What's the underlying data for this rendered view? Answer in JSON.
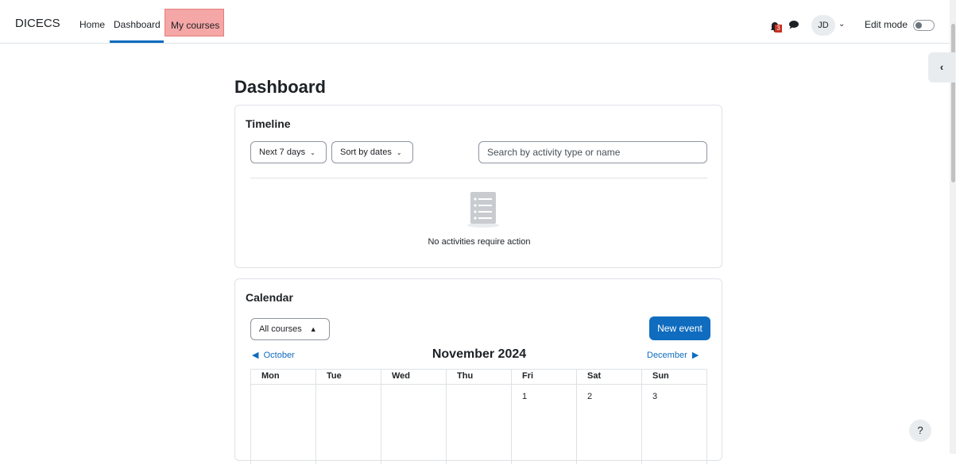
{
  "navbar": {
    "brand": "DICECS",
    "items": [
      {
        "label": "Home"
      },
      {
        "label": "Dashboard"
      },
      {
        "label": "My courses"
      }
    ],
    "notification_count": "3",
    "user_initials": "JD",
    "edit_mode_label": "Edit mode"
  },
  "help_label": "?",
  "page": {
    "title": "Dashboard"
  },
  "timeline": {
    "title": "Timeline",
    "filter_label": "Next 7 days",
    "sort_label": "Sort by dates",
    "search_placeholder": "Search by activity type or name",
    "empty_message": "No activities require action"
  },
  "calendar": {
    "title": "Calendar",
    "course_select": "All courses",
    "new_event_label": "New event",
    "prev_month": "October",
    "current_month": "November 2024",
    "next_month": "December",
    "weekdays": [
      "Mon",
      "Tue",
      "Wed",
      "Thu",
      "Fri",
      "Sat",
      "Sun"
    ],
    "first_row_days": [
      "",
      "",
      "",
      "",
      "1",
      "2",
      "3"
    ]
  },
  "colors": {
    "accent": "#0f6cbf",
    "highlight": "#f5a6a6",
    "badge": "#ca3120"
  }
}
